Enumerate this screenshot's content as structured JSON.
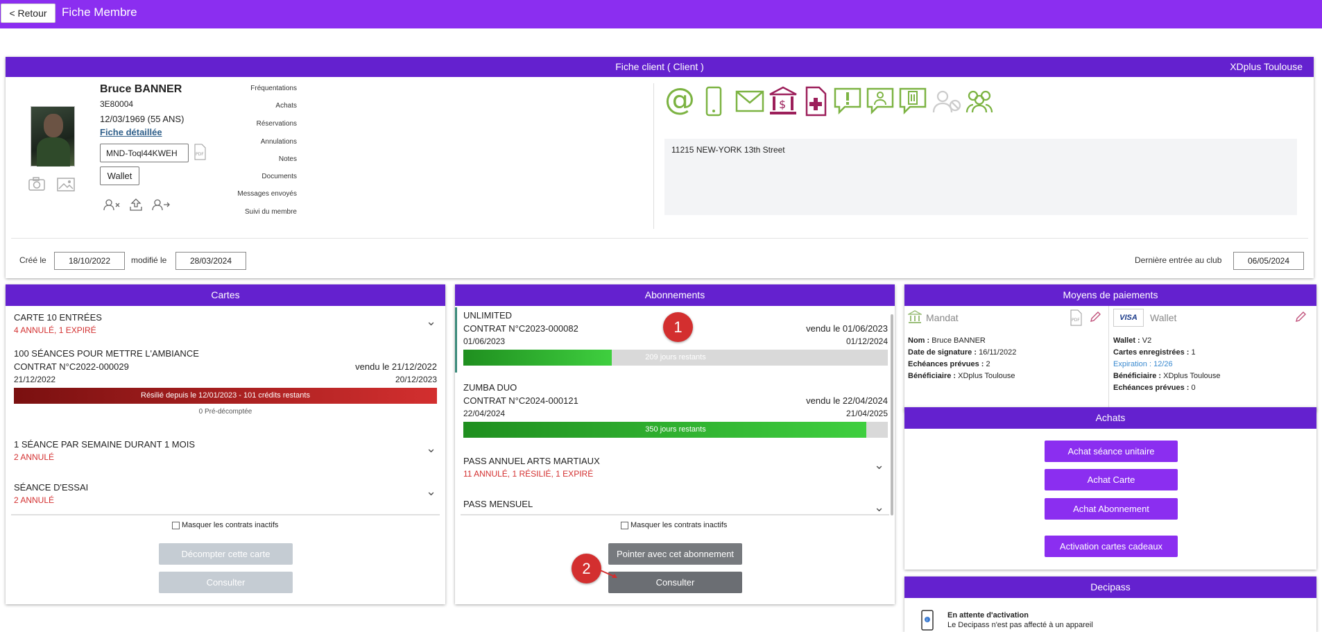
{
  "topbar": {
    "back_label": "< Retour",
    "title": "Fiche Membre"
  },
  "client": {
    "header": "Fiche client ( Client )",
    "club": "XDplus Toulouse",
    "name": "Bruce BANNER",
    "code": "3E80004",
    "birth": "12/03/1969 (55 ANS)",
    "detail_link": "Fiche détaillée",
    "mandate_id": "MND-Toql44KWEH",
    "wallet_label": "Wallet",
    "menu": [
      "Fréquentations",
      "Achats",
      "Réservations",
      "Annulations",
      "Notes",
      "Documents",
      "Messages envoyés",
      "Suivi du membre"
    ],
    "address": "11215 NEW-YORK 13th Street",
    "created_label": "Créé le",
    "created_value": "18/10/2022",
    "modified_label": "modifié le",
    "modified_value": "28/03/2024",
    "last_entry_label": "Dernière entrée au club",
    "last_entry_value": "06/05/2024",
    "icons": [
      "at-icon",
      "phone-icon",
      "envelope-icon",
      "bank-icon",
      "medical-document-icon",
      "alert-message-icon",
      "user-message-icon",
      "building-message-icon",
      "user-disabled-icon",
      "group-icon"
    ]
  },
  "cartes": {
    "header": "Cartes",
    "items": [
      {
        "title": "CARTE 10 ENTRÉES",
        "status": "4 ANNULÉ, 1 EXPIRÉ"
      },
      {
        "title": "100 SÉANCES POUR METTRE L'AMBIANCE",
        "contract": "CONTRAT N°C2022-000029",
        "sold": "vendu le 21/12/2022",
        "start": "21/12/2022",
        "end": "20/12/2023",
        "bar_text": "Résilié depuis le 12/01/2023 - 101 crédits restants",
        "sub": "0 Pré-décomptée"
      },
      {
        "title": "1 SÉANCE PAR SEMAINE DURANT 1 MOIS",
        "status": "2 ANNULÉ"
      },
      {
        "title": "SÉANCE D'ESSAI",
        "status": "2 ANNULÉ"
      }
    ],
    "hide_label": "Masquer les contrats inactifs",
    "btn_decompter": "Décompter cette carte",
    "btn_consulter": "Consulter"
  },
  "abonnements": {
    "header": "Abonnements",
    "items": [
      {
        "title": "UNLIMITED",
        "contract": "CONTRAT N°C2023-000082",
        "sold": "vendu le 01/06/2023",
        "start": "01/06/2023",
        "end": "01/12/2024",
        "bar_text": "209 jours restants",
        "progress": 0.35
      },
      {
        "title": "ZUMBA DUO",
        "contract": "CONTRAT N°C2024-000121",
        "sold": "vendu le 22/04/2024",
        "start": "22/04/2024",
        "end": "21/04/2025",
        "bar_text": "350 jours restants",
        "progress": 0.95
      },
      {
        "title": "PASS ANNUEL ARTS MARTIAUX",
        "status": "11 ANNULÉ, 1 RÉSILIÉ, 1 EXPIRÉ"
      },
      {
        "title": "PASS MENSUEL"
      }
    ],
    "hide_label": "Masquer les contrats inactifs",
    "btn_pointer": "Pointer avec cet abonnement",
    "btn_consulter": "Consulter",
    "marker1": "1",
    "marker2": "2"
  },
  "paiements": {
    "header": "Moyens de paiements",
    "mandat": {
      "title": "Mandat",
      "nom_label": "Nom :",
      "nom": "Bruce BANNER",
      "date_label": "Date de signature :",
      "date": "16/11/2022",
      "ech_label": "Echéances prévues :",
      "ech": "2",
      "benef_label": "Bénéficiaire :",
      "benef": "XDplus Toulouse"
    },
    "wallet": {
      "title": "Wallet",
      "visa": "VISA",
      "wallet_label": "Wallet :",
      "wallet": "V2",
      "cartes_label": "Cartes enregistrées :",
      "cartes": "1",
      "exp_label": "Expiration :",
      "exp": "12/26",
      "benef_label": "Bénéficiaire :",
      "benef": "XDplus Toulouse",
      "ech_label": "Echéances prévues :",
      "ech": "0"
    }
  },
  "achats": {
    "header": "Achats",
    "btn_seance": "Achat séance unitaire",
    "btn_carte": "Achat Carte",
    "btn_abonnement": "Achat Abonnement",
    "btn_cadeaux": "Activation cartes cadeaux"
  },
  "decipass": {
    "header": "Decipass",
    "status": "En attente d'activation",
    "desc": "Le Decipass n'est pas affecté à un appareil"
  }
}
